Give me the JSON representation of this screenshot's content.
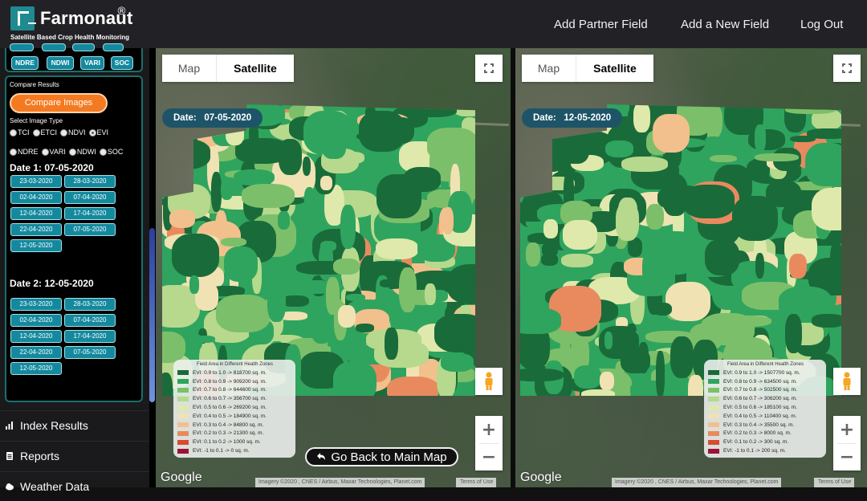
{
  "header": {
    "brand": "Farmonaut",
    "registered": "®",
    "tagline": "Satellite Based Crop Health Monitoring",
    "nav": [
      {
        "label": "Add Partner Field"
      },
      {
        "label": "Add a New Field"
      },
      {
        "label": "Log Out"
      }
    ]
  },
  "sidebar": {
    "index_buttons": [
      "NDRE",
      "NDWI",
      "VARI",
      "SOC"
    ],
    "compare_results_label": "Compare Results",
    "compare_button": "Compare Images",
    "select_image_type_label": "Select Image Type",
    "image_types_row1": [
      {
        "label": "TCI",
        "checked": false
      },
      {
        "label": "ETCI",
        "checked": false
      },
      {
        "label": "NDVI",
        "checked": false
      },
      {
        "label": "EVI",
        "checked": true
      }
    ],
    "image_types_row2": [
      {
        "label": "NDRE",
        "checked": false
      },
      {
        "label": "VARI",
        "checked": false
      },
      {
        "label": "NDWI",
        "checked": false
      },
      {
        "label": "SOC",
        "checked": false
      }
    ],
    "date1_label": "Date 1: 07-05-2020",
    "date2_label": "Date 2: 12-05-2020",
    "dates": [
      "23-03-2020",
      "28-03-2020",
      "02-04-2020",
      "07-04-2020",
      "12-04-2020",
      "17-04-2020",
      "22-04-2020",
      "07-05-2020",
      "12-05-2020"
    ],
    "menu": [
      {
        "label": "Index Results",
        "icon": "bar-chart-icon"
      },
      {
        "label": "Reports",
        "icon": "document-icon"
      },
      {
        "label": "Weather Data",
        "icon": "cloud-icon"
      }
    ]
  },
  "maps": [
    {
      "map_label": "Map",
      "satellite_label": "Satellite",
      "date_text": "Date:   07-05-2020",
      "legend_title": "Field Area in Different Health Zones",
      "legend": [
        {
          "label": "EVI: 0.9 to 1.0 -> 818700 sq. m.",
          "color": "#1a6b3a"
        },
        {
          "label": "EVI: 0.8 to 0.9 -> 909200 sq. m.",
          "color": "#2fa45e"
        },
        {
          "label": "EVI: 0.7 to 0.8 -> 644600 sq. m.",
          "color": "#7cbf6a"
        },
        {
          "label": "EVI: 0.6 to 0.7 -> 356700 sq. m.",
          "color": "#b6d98d"
        },
        {
          "label": "EVI: 0.5 to 0.6 -> 269200 sq. m.",
          "color": "#dfe9ac"
        },
        {
          "label": "EVI: 0.4 to 0.5 -> 184900 sq. m.",
          "color": "#f0e2b3"
        },
        {
          "label": "EVI: 0.3 to 0.4 -> 84800 sq. m.",
          "color": "#f2c08c"
        },
        {
          "label": "EVI: 0.2 to 0.3 -> 21300 sq. m.",
          "color": "#e88a5e"
        },
        {
          "label": "EVI: 0.1 to 0.2 -> 1000 sq. m.",
          "color": "#d94a34"
        },
        {
          "label": "EVI: -1 to 0.1 -> 0 sq. m.",
          "color": "#9b1238"
        }
      ],
      "google": "Google",
      "attribution": "Imagery ©2020 , CNES / Airbus, Maxar Technologies, Planet.com",
      "terms": "Terms of Use"
    },
    {
      "map_label": "Map",
      "satellite_label": "Satellite",
      "date_text": "Date:   12-05-2020",
      "legend_title": "Field Area in Different Health Zones",
      "legend": [
        {
          "label": "EVI: 0.9 to 1.0 -> 1507700 sq. m.",
          "color": "#1a6b3a"
        },
        {
          "label": "EVI: 0.8 to 0.9 -> 634500 sq. m.",
          "color": "#2fa45e"
        },
        {
          "label": "EVI: 0.7 to 0.8 -> 502500 sq. m.",
          "color": "#7cbf6a"
        },
        {
          "label": "EVI: 0.6 to 0.7 -> 306200 sq. m.",
          "color": "#b6d98d"
        },
        {
          "label": "EVI: 0.5 to 0.6 -> 185100 sq. m.",
          "color": "#dfe9ac"
        },
        {
          "label": "EVI: 0.4 to 0.5 -> 110400 sq. m.",
          "color": "#f0e2b3"
        },
        {
          "label": "EVI: 0.3 to 0.4 -> 35500 sq. m.",
          "color": "#f2c08c"
        },
        {
          "label": "EVI: 0.2 to 0.3 -> 8000 sq. m.",
          "color": "#e88a5e"
        },
        {
          "label": "EVI: 0.1 to 0.2 -> 300 sq. m.",
          "color": "#d94a34"
        },
        {
          "label": "EVI: -1 to 0.1 -> 200 sq. m.",
          "color": "#9b1238"
        }
      ],
      "google": "Google",
      "attribution": "Imagery ©2020 , CNES / Airbus, Maxar Technologies, Planet.com",
      "terms": "Terms of Use"
    }
  ],
  "back_button": "Go Back to Main Map"
}
